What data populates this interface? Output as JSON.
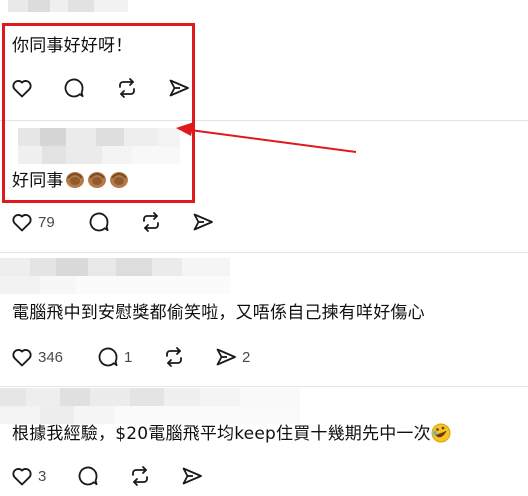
{
  "posts": [
    {
      "text": "你同事好好呀！",
      "counts": {
        "like": "",
        "reply": "",
        "repost": "",
        "share": ""
      }
    },
    {
      "text": "好同事",
      "emoji": [
        "clap-emoji",
        "clap-emoji",
        "clap-emoji"
      ],
      "counts": {
        "like": "79",
        "reply": "",
        "repost": "",
        "share": ""
      }
    },
    {
      "text": "電腦飛中到安慰獎都偷笑啦，又唔係自己揀有咩好傷心",
      "counts": {
        "like": "346",
        "reply": "1",
        "repost": "",
        "share": "2"
      }
    },
    {
      "text": "根據我經驗，$20電腦飛平均keep住買十幾期先中一次",
      "emoji": [
        "rolling-laugh-emoji"
      ],
      "counts": {
        "like": "3",
        "reply": "",
        "repost": "",
        "share": ""
      }
    }
  ],
  "colors": {
    "highlight": "#e0191d",
    "icon": "#1a1a1a",
    "count": "#4a4a4a",
    "divider": "#e4e4e4"
  }
}
